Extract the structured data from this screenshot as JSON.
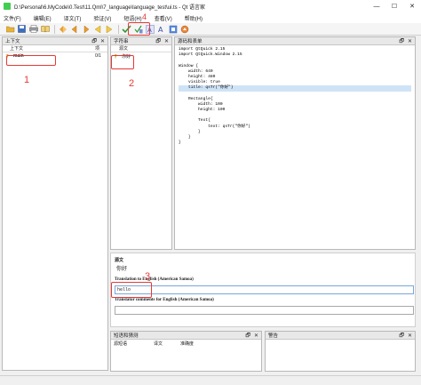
{
  "window": {
    "title": "D:\\Personal\\6.MyCode\\0.Test\\11.Qml\\7_language\\language_test\\ui.ts - Qt 语言家",
    "minimize": "—",
    "maximize": "☐",
    "close": "✕"
  },
  "menu": [
    "文件(F)",
    "编辑(E)",
    "译文(T)",
    "验证(V)",
    "短语(H)",
    "查看(V)",
    "帮助(H)"
  ],
  "toolbar": {
    "icons": [
      "open-icon",
      "save-icon",
      "print-icon",
      "book-icon",
      "undo-icon",
      "prev-icon",
      "next-icon",
      "prev-unfinished-icon",
      "next-unfinished-icon",
      "done-next-icon",
      "accelerator-icon",
      "punctuation-icon",
      "phrase-icon",
      "placemarker-icon",
      "surrounding-icon"
    ]
  },
  "context_panel": {
    "title": "上下文",
    "float": "🗗",
    "close": "✕",
    "header_col": "上下文",
    "header_count": "项",
    "rows": [
      {
        "name": "main",
        "count": "0/1"
      }
    ]
  },
  "strings_panel": {
    "title": "字符串",
    "float": "🗗",
    "close": "✕",
    "header_col": "源文",
    "rows": [
      {
        "text": "你好"
      }
    ]
  },
  "sources_panel": {
    "title": "源码和表单",
    "float": "🗗",
    "close": "✕",
    "code_lines": [
      "import QtQuick 2.15",
      "import QtQuick.Window 2.15",
      "",
      "Window {",
      "    width: 640",
      "    height: 480",
      "    visible: true",
      "    title: qsTr(\"你好\")",
      "",
      "    Rectangle{",
      "        width: 100",
      "        height: 100",
      "",
      "        Text{",
      "            text: qsTr(\"你好\")",
      "        }",
      "    }",
      "}"
    ],
    "highlight_line": 7
  },
  "editor": {
    "source_label": "源文",
    "source_text": "你好",
    "translation_label": "Translation to English (American Samoa)",
    "translation_value": "hello",
    "comments_label": "Translator comments for English (American Samoa)",
    "comments_value": ""
  },
  "phrases_panel": {
    "title": "短语和猜测",
    "float": "🗗",
    "close": "✕",
    "cols": [
      "源短语",
      "译文",
      "准确度"
    ]
  },
  "warnings_panel": {
    "title": "警告",
    "float": "🗗",
    "close": "✕"
  },
  "annotations": [
    "1",
    "2",
    "3",
    "4"
  ],
  "colors": {
    "annotation": "#e53935",
    "highlight": "#cfe3f7",
    "input_border": "#7aa7d8"
  }
}
